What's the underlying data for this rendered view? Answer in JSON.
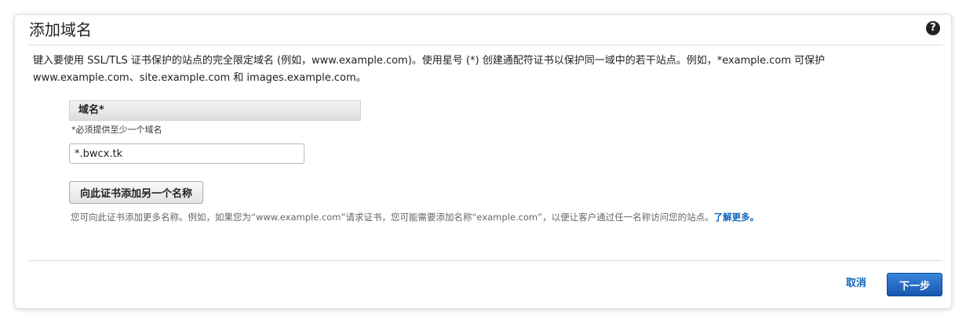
{
  "header": {
    "title": "添加域名",
    "help_icon_glyph": "?"
  },
  "description": "键入要使用 SSL/TLS 证书保护的站点的完全限定域名 (例如，www.example.com)。使用星号 (*) 创建通配符证书以保护同一域中的若干站点。例如，*example.com 可保护 www.example.com、site.example.com 和 images.example.com。",
  "domain_field": {
    "header_label": "域名*",
    "required_note": "*必须提供至少一个域名",
    "value": "*.bwcx.tk"
  },
  "add_name_button_label": "向此证书添加另一个名称",
  "hint": {
    "text": "您可向此证书添加更多名称。例如，如果您为“www.example.com”请求证书，您可能需要添加名称“example.com”，以便让客户通过任一名称访问您的站点。",
    "learn_more_link": "了解更多。"
  },
  "footer": {
    "cancel_label": "取消",
    "next_label": "下一步"
  },
  "colors": {
    "link": "#1166bb",
    "primary_button": "#1f66c2",
    "header_bar": "#e6e6e6"
  },
  "icons": {
    "help": "question-circle-icon"
  }
}
